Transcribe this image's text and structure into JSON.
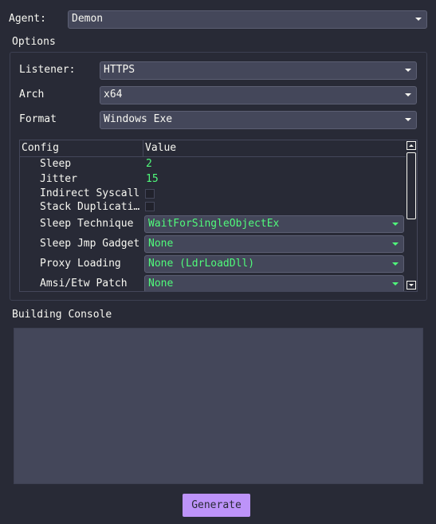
{
  "agent": {
    "label": "Agent:",
    "value": "Demon"
  },
  "options": {
    "title": "Options",
    "listener": {
      "label": "Listener:",
      "value": "HTTPS"
    },
    "arch": {
      "label": "Arch",
      "value": "x64"
    },
    "format": {
      "label": "Format",
      "value": "Windows Exe"
    }
  },
  "config_table": {
    "headers": {
      "config": "Config",
      "value": "Value"
    },
    "rows": [
      {
        "name": "Sleep",
        "value": "2"
      },
      {
        "name": "Jitter",
        "value": "15"
      },
      {
        "name": "Indirect Syscall",
        "checked": false
      },
      {
        "name": "Stack Duplicati…",
        "checked": false
      },
      {
        "name": "Sleep Technique",
        "value": "WaitForSingleObjectEx"
      },
      {
        "name": "Sleep Jmp Gadget",
        "value": "None"
      },
      {
        "name": "Proxy Loading",
        "value": "None (LdrLoadDll)"
      },
      {
        "name": "Amsi/Etw Patch",
        "value": "None"
      }
    ]
  },
  "console": {
    "title": "Building Console",
    "content": ""
  },
  "generate": {
    "label": "Generate"
  },
  "colors": {
    "background": "#282a36",
    "field": "#44475a",
    "accent_green": "#50fa7b",
    "button": "#bd93f9",
    "text": "#f8f8f2"
  }
}
